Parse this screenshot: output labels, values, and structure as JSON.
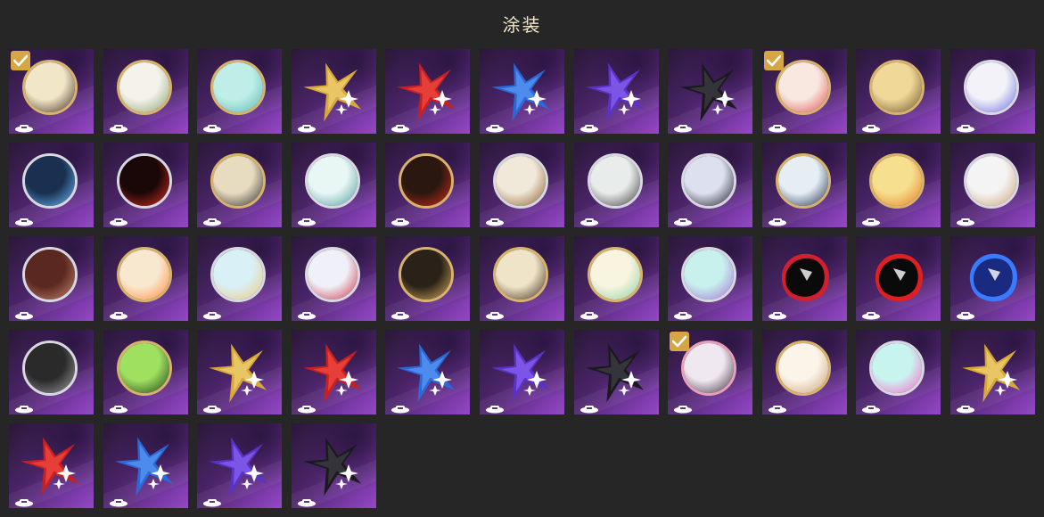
{
  "header": {
    "title": "涂装"
  },
  "colors": {
    "check": "#d6a645",
    "tile_dark": "#2a1838",
    "tile_light": "#9448c4"
  },
  "tiles": [
    {
      "type": "emblem",
      "ring": "gold",
      "name": "emblem-dark-character-icon",
      "c1": "#f2e6c8",
      "c2": "#3a2a1e",
      "checked": true
    },
    {
      "type": "emblem",
      "ring": "gold",
      "name": "emblem-white-creature-icon",
      "c1": "#f4f2ea",
      "c2": "#8aa070"
    },
    {
      "type": "emblem",
      "ring": "gold",
      "name": "emblem-teal-wave-icon",
      "c1": "#bfeee8",
      "c2": "#5ab8b0"
    },
    {
      "type": "star",
      "name": "star-gold-icon",
      "c1": "#d8a838",
      "c2": "#f6dc8a"
    },
    {
      "type": "star",
      "name": "star-red-icon",
      "c1": "#c82020",
      "c2": "#ff5a4a"
    },
    {
      "type": "star",
      "name": "star-blue-icon",
      "c1": "#2a6ad8",
      "c2": "#6aa8ff"
    },
    {
      "type": "star",
      "name": "star-purple-icon",
      "c1": "#5a32c8",
      "c2": "#9a72ff"
    },
    {
      "type": "star",
      "name": "star-black-icon",
      "c1": "#1a1a1e",
      "c2": "#4a4a52"
    },
    {
      "type": "emblem",
      "ring": "gold",
      "name": "emblem-cartoon-collage-icon",
      "c1": "#f8e8e0",
      "c2": "#e05050",
      "checked": true
    },
    {
      "type": "emblem",
      "ring": "gold",
      "name": "emblem-gold-gear-icon",
      "c1": "#f0d898",
      "c2": "#6a5028"
    },
    {
      "type": "emblem",
      "ring": "silver",
      "name": "emblem-winged-crest-icon",
      "c1": "#f2f2f8",
      "c2": "#6a6ae0"
    },
    {
      "type": "emblem",
      "ring": "silver",
      "name": "emblem-glowing-tree-icon",
      "c1": "#1a3050",
      "c2": "#6ac0ff"
    },
    {
      "type": "emblem",
      "ring": "silver",
      "name": "emblem-red-flame-icon",
      "c1": "#1a0808",
      "c2": "#e03020"
    },
    {
      "type": "emblem",
      "ring": "gold",
      "name": "emblem-beige-planet-icon",
      "c1": "#e8dcc0",
      "c2": "#2a2a2a"
    },
    {
      "type": "emblem",
      "ring": "silver",
      "name": "emblem-mint-dragon-icon",
      "c1": "#e8f6f4",
      "c2": "#4a9a9a"
    },
    {
      "type": "emblem",
      "ring": "gold",
      "name": "emblem-red-bird-icon",
      "c1": "#2a1810",
      "c2": "#d82a1a"
    },
    {
      "type": "emblem",
      "ring": "silver",
      "name": "emblem-warrior-icon",
      "c1": "#f0e8d8",
      "c2": "#8a5a2a"
    },
    {
      "type": "emblem",
      "ring": "silver",
      "name": "emblem-skull-knight-icon",
      "c1": "#e8ecea",
      "c2": "#3a3a3a"
    },
    {
      "type": "emblem",
      "ring": "silver",
      "name": "emblem-dark-hair-boy-icon",
      "c1": "#dde0ee",
      "c2": "#1a1a28"
    },
    {
      "type": "emblem",
      "ring": "gold",
      "name": "emblem-volleyball-player-icon",
      "c1": "#e6eef4",
      "c2": "#1a2a4a"
    },
    {
      "type": "emblem",
      "ring": "gold",
      "name": "emblem-orange-hair-player-icon",
      "c1": "#f6e090",
      "c2": "#e87a20"
    },
    {
      "type": "emblem",
      "ring": "silver",
      "name": "emblem-chibi-group-icon",
      "c1": "#f4f4f4",
      "c2": "#c8a070"
    },
    {
      "type": "emblem",
      "ring": "silver",
      "name": "emblem-twin-girls-icon",
      "c1": "#5a2820",
      "c2": "#c88a70"
    },
    {
      "type": "emblem",
      "ring": "gold",
      "name": "emblem-orange-crest-icon",
      "c1": "#f8e8d0",
      "c2": "#ff8a3a"
    },
    {
      "type": "emblem",
      "ring": "silver",
      "name": "emblem-blonde-girl-icon",
      "c1": "#d8f0f6",
      "c2": "#f0c878"
    },
    {
      "type": "emblem",
      "ring": "silver",
      "name": "emblem-red-blue-swirl-icon",
      "c1": "#f0f0f8",
      "c2": "#c83040"
    },
    {
      "type": "emblem",
      "ring": "gold",
      "name": "emblem-gold-rocket-icon",
      "c1": "#2a2218",
      "c2": "#d8b060"
    },
    {
      "type": "emblem",
      "ring": "gold",
      "name": "emblem-gold-claw-icon",
      "c1": "#f0e4c8",
      "c2": "#3a2a18"
    },
    {
      "type": "emblem",
      "ring": "gold",
      "name": "emblem-white-fox-icon",
      "c1": "#f8f4e0",
      "c2": "#8ad0a0"
    },
    {
      "type": "emblem",
      "ring": "silver",
      "name": "emblem-aqua-gem-icon",
      "c1": "#c8f0ec",
      "c2": "#a070d8"
    },
    {
      "type": "blob",
      "name": "shadow-hedgehog-icon",
      "c1": "#0a0a0a",
      "c2": "#d02030"
    },
    {
      "type": "blob",
      "name": "red-masked-hero-icon",
      "c1": "#0a0a0a",
      "c2": "#e02020"
    },
    {
      "type": "blob",
      "name": "blue-hair-hero-icon",
      "c1": "#1a2a80",
      "c2": "#3a7aff"
    },
    {
      "type": "emblem",
      "ring": "silver",
      "name": "emblem-dark-ruins-icon",
      "c1": "#2a2a2a",
      "c2": "#a0a0a0"
    },
    {
      "type": "emblem",
      "ring": "gold",
      "name": "emblem-green-pixel-icon",
      "c1": "#a0e060",
      "c2": "#1a3a18"
    },
    {
      "type": "star",
      "name": "star-gold-icon",
      "c1": "#d8a838",
      "c2": "#f6dc8a"
    },
    {
      "type": "star",
      "name": "star-red-icon",
      "c1": "#c82020",
      "c2": "#ff5a4a"
    },
    {
      "type": "star",
      "name": "star-blue-icon",
      "c1": "#2a6ad8",
      "c2": "#6aa8ff"
    },
    {
      "type": "star",
      "name": "star-purple-icon",
      "c1": "#5a32c8",
      "c2": "#9a72ff"
    },
    {
      "type": "star",
      "name": "star-black-icon",
      "c1": "#1a1a1e",
      "c2": "#4a4a52"
    },
    {
      "type": "emblem",
      "ring": "pink",
      "name": "emblem-couple-portrait-icon",
      "c1": "#f0e8f0",
      "c2": "#3a2a3a",
      "checked": true
    },
    {
      "type": "emblem",
      "ring": "gold",
      "name": "emblem-cream-dog-icon",
      "c1": "#fbf4e8",
      "c2": "#c8a070"
    },
    {
      "type": "emblem",
      "ring": "silver",
      "name": "emblem-pink-cat-icon",
      "c1": "#c8f4f0",
      "c2": "#ff60c8"
    },
    {
      "type": "star",
      "name": "star-gold-icon",
      "c1": "#d8a838",
      "c2": "#f6dc8a"
    },
    {
      "type": "star",
      "name": "star-red-icon",
      "c1": "#c82020",
      "c2": "#ff5a4a"
    },
    {
      "type": "star",
      "name": "star-blue-icon",
      "c1": "#2a6ad8",
      "c2": "#6aa8ff"
    },
    {
      "type": "star",
      "name": "star-purple-icon",
      "c1": "#5a32c8",
      "c2": "#9a72ff"
    },
    {
      "type": "star",
      "name": "star-black-icon",
      "c1": "#1a1a1e",
      "c2": "#4a4a52"
    }
  ]
}
